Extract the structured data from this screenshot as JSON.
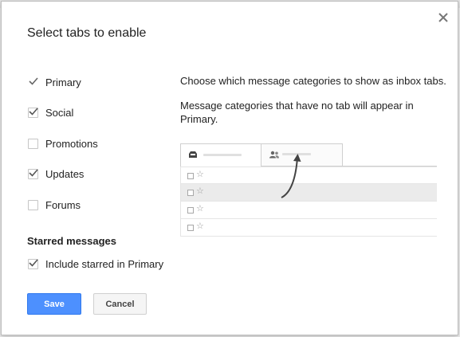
{
  "dialog": {
    "title": "Select tabs to enable",
    "close_icon": "close-icon"
  },
  "tabs": [
    {
      "label": "Primary",
      "checked": true,
      "locked": true
    },
    {
      "label": "Social",
      "checked": true
    },
    {
      "label": "Promotions",
      "checked": false
    },
    {
      "label": "Updates",
      "checked": true
    },
    {
      "label": "Forums",
      "checked": false
    }
  ],
  "starred": {
    "heading": "Starred messages",
    "option_label": "Include starred in Primary",
    "checked": true
  },
  "buttons": {
    "save_label": "Save",
    "cancel_label": "Cancel"
  },
  "description": {
    "line1": "Choose which message categories to show as inbox tabs.",
    "line2a": "Message categories that have no tab will appear in",
    "line2b": "Primary."
  },
  "preview": {
    "tab_icons": [
      "inbox-icon",
      "people-icon"
    ],
    "rows": 4,
    "star_glyph": "☆"
  },
  "colors": {
    "primary_button": "#4d90fe",
    "check": "#555555"
  }
}
